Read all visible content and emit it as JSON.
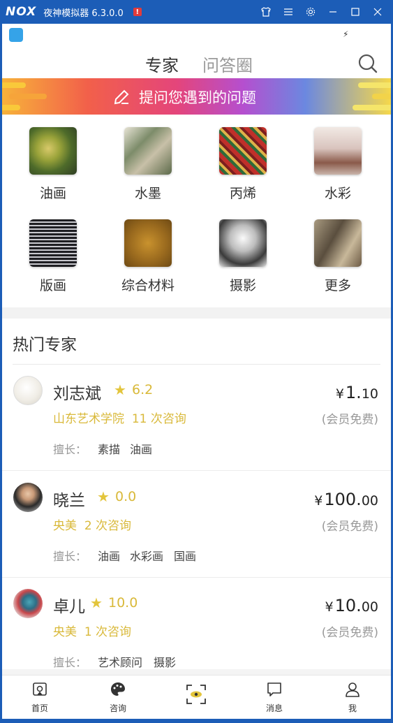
{
  "window": {
    "logo": "NOX",
    "title": "夜神模拟器 6.3.0.0",
    "alert": "!"
  },
  "topnav": {
    "tabs": [
      {
        "label": "专家",
        "active": true
      },
      {
        "label": "问答圈",
        "active": false
      }
    ]
  },
  "banner": {
    "text": "提问您遇到的问题"
  },
  "categories": [
    {
      "label": "油画"
    },
    {
      "label": "水墨"
    },
    {
      "label": "丙烯"
    },
    {
      "label": "水彩"
    },
    {
      "label": "版画"
    },
    {
      "label": "综合材料"
    },
    {
      "label": "摄影"
    },
    {
      "label": "更多"
    }
  ],
  "hot_experts": {
    "title": "热门专家",
    "spec_label": "擅长：",
    "items": [
      {
        "name": "刘志斌",
        "rating": "6.2",
        "org": "山东艺术学院",
        "consults": "11 次咨询",
        "specialties": [
          "素描",
          "油画"
        ],
        "price_yen": "¥",
        "price_int": "1.",
        "price_dec": "10",
        "member_note": "(会员免费)"
      },
      {
        "name": "晓兰",
        "rating": "0.0",
        "org": "央美",
        "consults": "2 次咨询",
        "specialties": [
          "油画",
          "水彩画",
          "国画"
        ],
        "price_yen": "¥",
        "price_int": "100.",
        "price_dec": "00",
        "member_note": "(会员免费)"
      },
      {
        "name": "卓儿",
        "rating": "10.0",
        "org": "央美",
        "consults": "1 次咨询",
        "specialties": [
          "艺术顾问",
          "摄影"
        ],
        "price_yen": "¥",
        "price_int": "10.",
        "price_dec": "00",
        "member_note": "(会员免费)"
      }
    ]
  },
  "bottomnav": [
    {
      "label": "首页",
      "icon": "home-icon"
    },
    {
      "label": "咨询",
      "icon": "palette-icon"
    },
    {
      "label": "",
      "icon": "scan-icon"
    },
    {
      "label": "消息",
      "icon": "message-icon"
    },
    {
      "label": "我",
      "icon": "user-icon"
    }
  ],
  "colors": {
    "window_blue": "#1c5db7",
    "accent_gold": "#d9b93a",
    "text_dark": "#333333",
    "text_grey": "#999999"
  }
}
